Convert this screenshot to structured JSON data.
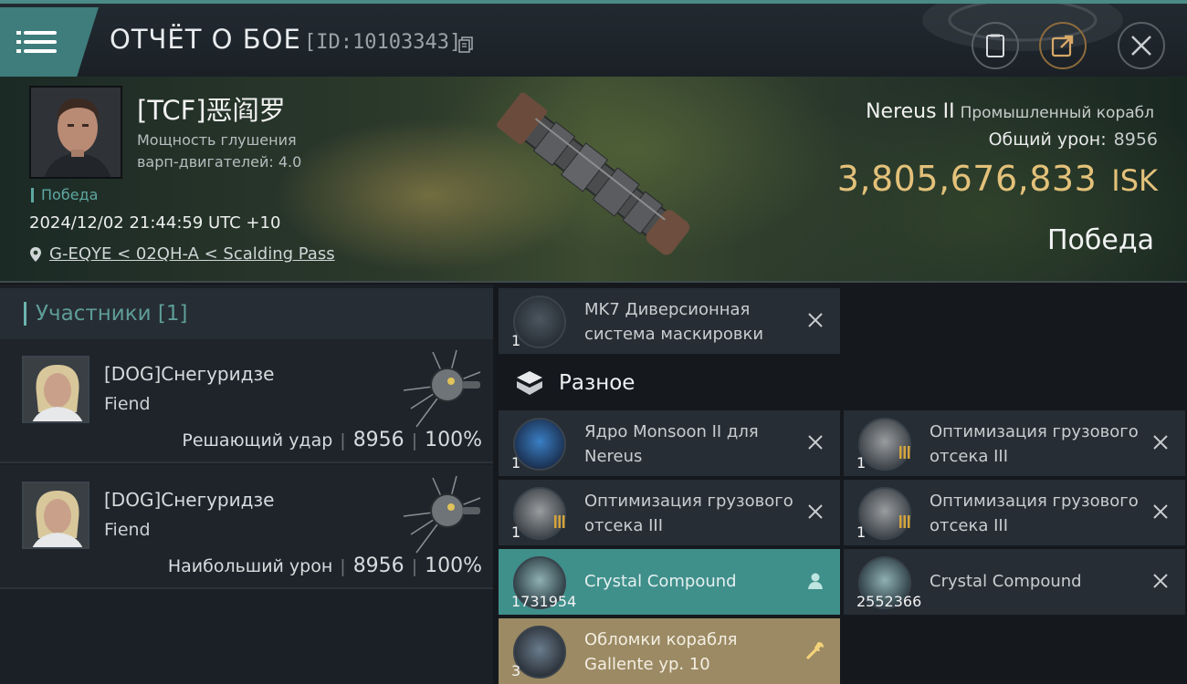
{
  "header": {
    "title": "ОТЧЁТ О БОЕ",
    "report_id": "[ID:10103343]"
  },
  "victim": {
    "name": "[TCF]恶阎罗",
    "warp_label": "Мощность глушения варп-двигателей: 4.0",
    "status": "Победа",
    "timestamp": "2024/12/02 21:44:59 UTC +10",
    "location": "G-EQYE < 02QH-A < Scalding Pass",
    "ship_name": "Nereus II",
    "ship_class": "Промышленный корабл",
    "damage_label": "Общий урон:",
    "damage_value": "8956",
    "isk_value": "3,805,676,833",
    "isk_unit": "ISK",
    "result": "Победа"
  },
  "participants": {
    "header": "Участники [1]",
    "rows": [
      {
        "name": "[DOG]Снегуридзе",
        "ship": "Fiend",
        "role": "Решающий удар",
        "damage": "8956",
        "percent": "100%"
      },
      {
        "name": "[DOG]Снегуридзе",
        "ship": "Fiend",
        "role": "Наибольший урон",
        "damage": "8956",
        "percent": "100%"
      }
    ]
  },
  "items": {
    "cloak": {
      "name": "MK7 Диверсионная система маскировки",
      "qty": "1"
    },
    "misc_header": "Разное",
    "misc": [
      {
        "name": "Ядро Monsoon II для Nereus",
        "qty": "1"
      },
      {
        "name": "Оптимизация грузового отсека III",
        "qty": "1"
      },
      {
        "name": "Оптимизация грузового отсека III",
        "qty": "1"
      },
      {
        "name": "Оптимизация грузового отсека III",
        "qty": "1"
      },
      {
        "name": "Crystal Compound",
        "qty": "1731954"
      },
      {
        "name": "Crystal Compound",
        "qty": "2552366"
      },
      {
        "name": "Обломки корабля Gallente ур. 10",
        "qty": "3"
      }
    ]
  },
  "colors": {
    "accent_teal": "#3f8f8b",
    "isk_gold": "#e3c17a",
    "dropped_gold": "#9b8a63"
  },
  "icons": [
    "menu-icon",
    "copy-icon",
    "clipboard-icon",
    "share-icon",
    "close-icon",
    "location-pin-icon",
    "cube-icon",
    "remove-icon",
    "person-icon",
    "wrench-icon"
  ]
}
